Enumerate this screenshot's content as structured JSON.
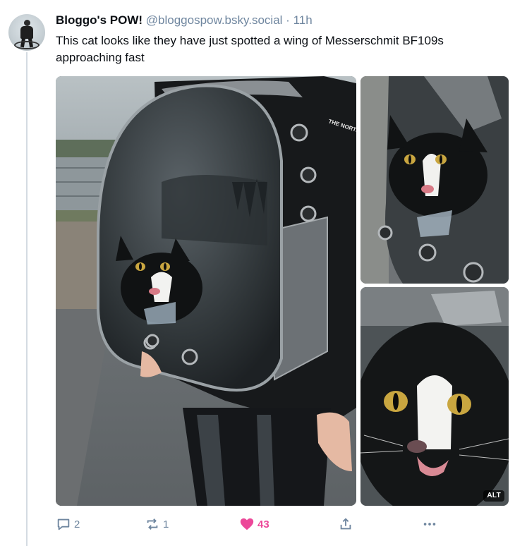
{
  "post": {
    "display_name": "Bloggo's POW!",
    "handle": "@bloggospow.bsky.social",
    "separator": "·",
    "time": "11h",
    "text": "This cat looks like they have just spotted a wing of Messerschmit BF109s approaching fast"
  },
  "media": {
    "alt_badge": "ALT",
    "backpack_brand": "THE NORTH FACE"
  },
  "actions": {
    "reply_count": "2",
    "repost_count": "1",
    "like_count": "43",
    "liked": true
  },
  "colors": {
    "text": "#0b0f14",
    "muted": "#6f869f",
    "like": "#ec4899",
    "thread_line": "#d4dbe2"
  },
  "icons": {
    "reply": "speech-bubble-icon",
    "repost": "repost-arrows-icon",
    "like": "heart-icon",
    "share": "share-upload-icon",
    "more": "ellipsis-icon"
  }
}
